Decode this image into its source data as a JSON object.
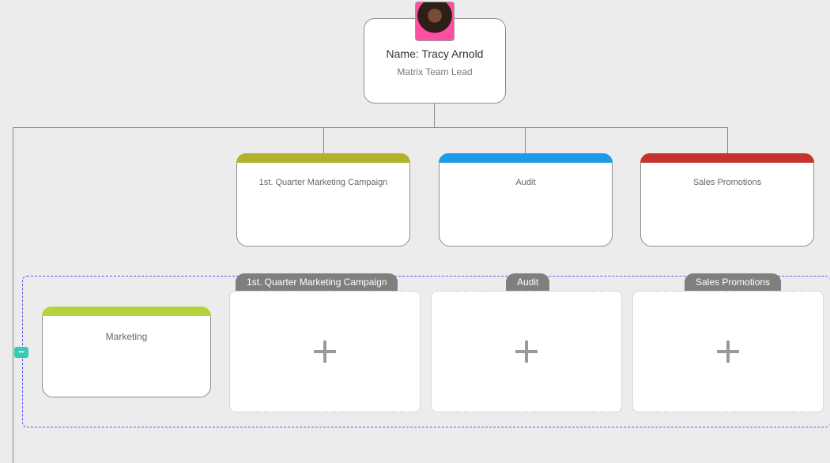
{
  "root": {
    "name_line": "Name: Tracy Arnold",
    "role": "Matrix Team Lead"
  },
  "categories": [
    {
      "label": "1st. Quarter Marketing Campaign",
      "color": "#b0b32c"
    },
    {
      "label": "Audit",
      "color": "#1e9be8"
    },
    {
      "label": "Sales Promotions",
      "color": "#c5332e"
    }
  ],
  "matrix": {
    "collapse_glyph": "−",
    "row_label": "Marketing",
    "row_color": "#b6d23a",
    "columns": [
      "1st. Quarter Marketing Campaign",
      "Audit",
      "Sales Promotions"
    ]
  }
}
